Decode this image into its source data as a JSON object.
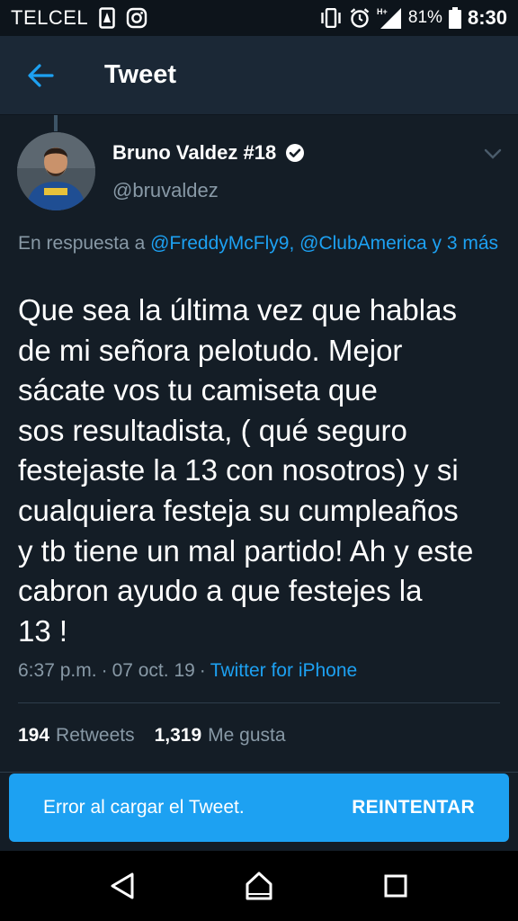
{
  "status_bar": {
    "carrier": "TELCEL",
    "battery": "81%",
    "time": "8:30",
    "icons": [
      "sim-icon",
      "instagram-icon",
      "vibrate-icon",
      "alarm-icon",
      "signal-icon",
      "battery-icon"
    ]
  },
  "app_bar": {
    "title": "Tweet"
  },
  "tweet": {
    "author_name": "Bruno Valdez #18",
    "verified": true,
    "handle": "@bruvaldez",
    "reply_prefix": "En respuesta a",
    "reply_mentions": "@FreddyMcFly9, @ClubAmerica y 3 más",
    "text": "Que sea la última vez que hablas\nde mi señora pelotudo.  Mejor\nsácate vos tu camiseta que\nsos resultadista, ( qué seguro\nfestejaste la 13 con nosotros) y si\ncualquiera festeja su cumpleaños\ny tb tiene un mal partido! Ah y este\ncabron ayudo a que festejes la\n13 !",
    "time": "6:37 p.m.",
    "sep1": "·",
    "date": "07 oct. 19",
    "sep2": "·",
    "source": "Twitter for iPhone",
    "retweets_count": "194",
    "retweets_label": "Retweets",
    "likes_count": "1,319",
    "likes_label": "Me gusta"
  },
  "snackbar": {
    "message": "Error al cargar el Tweet.",
    "action": "REINTENTAR"
  },
  "colors": {
    "background": "#141d26",
    "app_bar": "#1b2836",
    "accent": "#1da1f2",
    "secondary_text": "#8899a6"
  }
}
